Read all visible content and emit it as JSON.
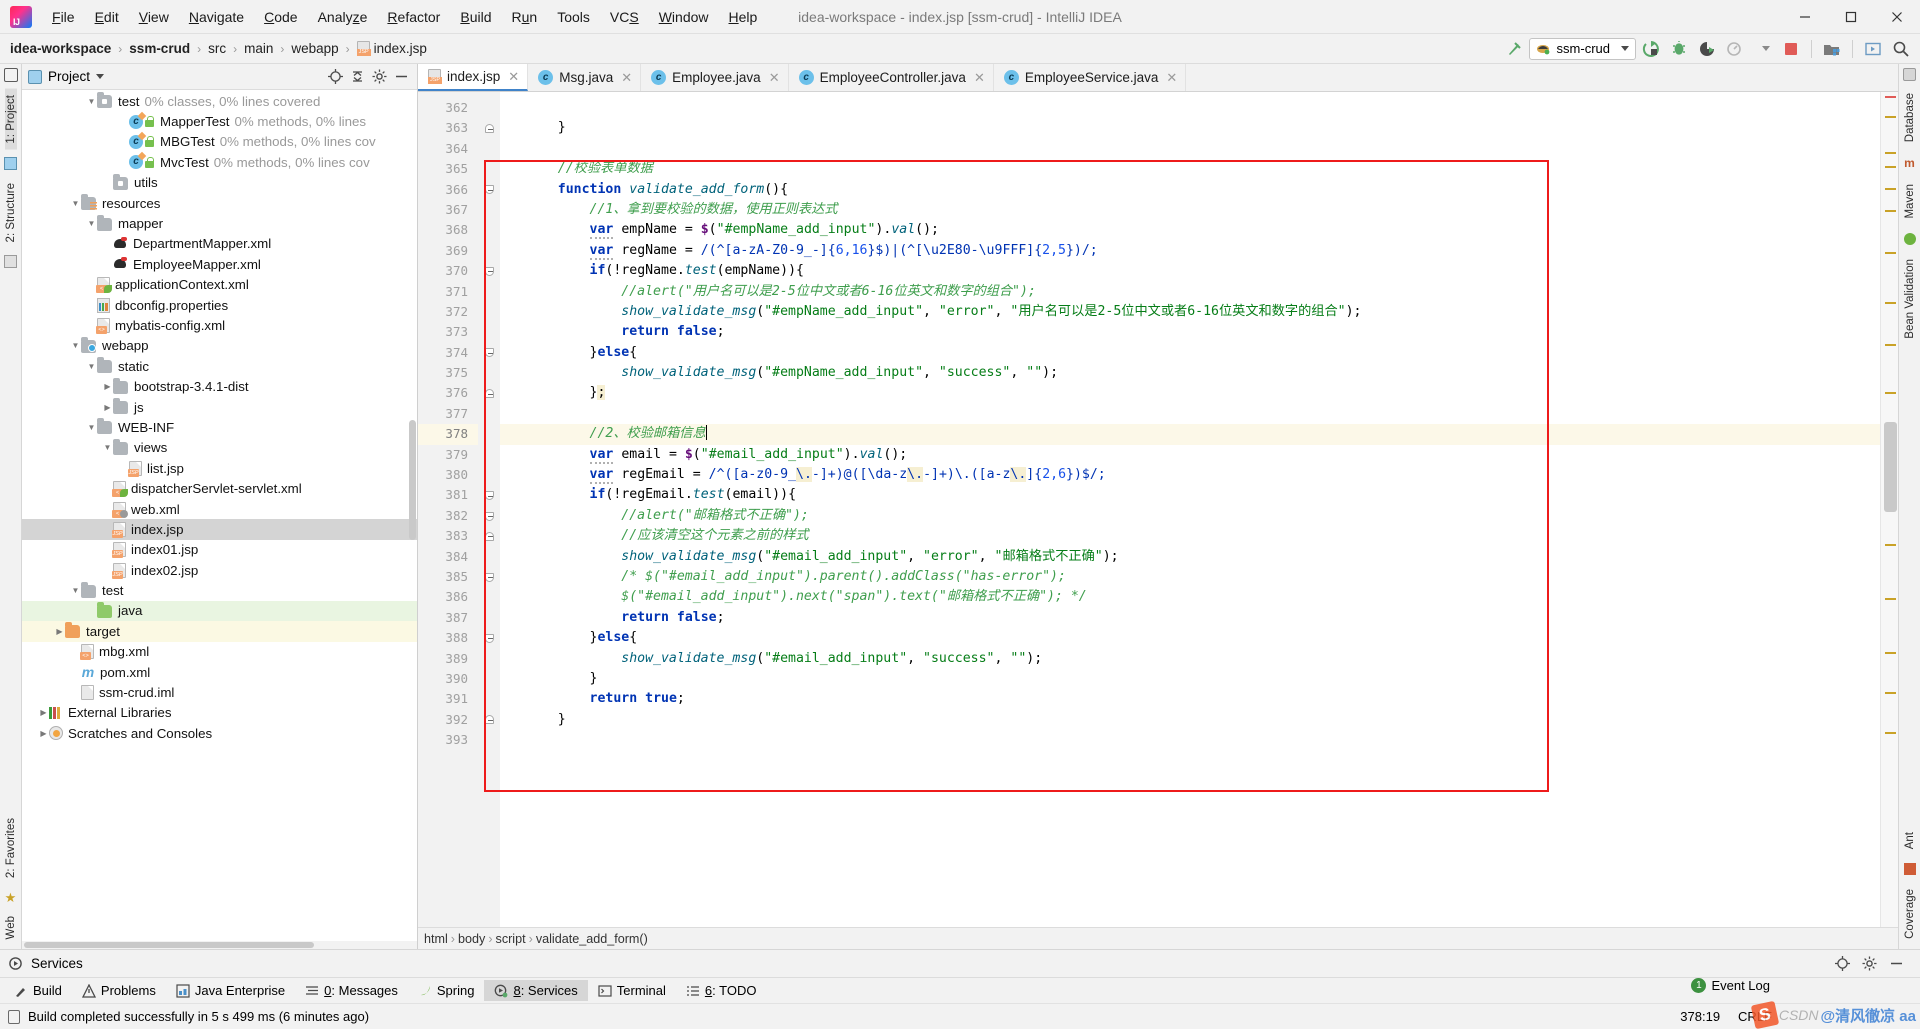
{
  "window": {
    "title": "idea-workspace - index.jsp [ssm-crud] - IntelliJ IDEA",
    "minimize": "─",
    "maximize": "☐",
    "close": "✕"
  },
  "menu": [
    "File",
    "Edit",
    "View",
    "Navigate",
    "Code",
    "Analyze",
    "Refactor",
    "Build",
    "Run",
    "Tools",
    "VCS",
    "Window",
    "Help"
  ],
  "breadcrumb": {
    "segments": [
      "idea-workspace",
      "ssm-crud",
      "src",
      "main",
      "webapp",
      "index.jsp"
    ],
    "separator": "›"
  },
  "toolbar": {
    "run_config": "ssm-crud",
    "icons": [
      "build-hammer-icon",
      "run-icon",
      "debug-icon",
      "run-coverage-icon",
      "profiler-icon",
      "stop-icon",
      "project-structure-icon",
      "updates-icon",
      "search-everywhere-icon"
    ]
  },
  "left_rail": {
    "top": [
      "1: Project",
      "2: Structure"
    ],
    "bottom": [
      "2: Favorites",
      "Web"
    ]
  },
  "right_rail": {
    "top": [
      "Database",
      "Maven",
      "Bean Validation"
    ],
    "bottom": [
      "Ant",
      "Coverage"
    ]
  },
  "project_panel": {
    "title": "Project",
    "tree": [
      {
        "indent": 4,
        "arrow": "down",
        "icon": "folder-test",
        "label": "test",
        "coverage": "0% classes, 0% lines covered"
      },
      {
        "indent": 6,
        "arrow": "none",
        "icon": "class-test",
        "label": "MapperTest",
        "coverage": "0% methods, 0% lines"
      },
      {
        "indent": 6,
        "arrow": "none",
        "icon": "class-test",
        "label": "MBGTest",
        "coverage": "0% methods, 0% lines cov"
      },
      {
        "indent": 6,
        "arrow": "none",
        "icon": "class-test",
        "label": "MvcTest",
        "coverage": "0% methods, 0% lines cov"
      },
      {
        "indent": 5,
        "arrow": "none",
        "icon": "folder-test",
        "label": "utils",
        "coverage": ""
      },
      {
        "indent": 3,
        "arrow": "down",
        "icon": "folder-resources",
        "label": "resources",
        "coverage": ""
      },
      {
        "indent": 4,
        "arrow": "down",
        "icon": "folder-plain",
        "label": "mapper",
        "coverage": ""
      },
      {
        "indent": 5,
        "arrow": "none",
        "icon": "mybatis",
        "label": "DepartmentMapper.xml",
        "coverage": ""
      },
      {
        "indent": 5,
        "arrow": "none",
        "icon": "mybatis",
        "label": "EmployeeMapper.xml",
        "coverage": ""
      },
      {
        "indent": 4,
        "arrow": "none",
        "icon": "spring-xml",
        "label": "applicationContext.xml",
        "coverage": ""
      },
      {
        "indent": 4,
        "arrow": "none",
        "icon": "properties",
        "label": "dbconfig.properties",
        "coverage": ""
      },
      {
        "indent": 4,
        "arrow": "none",
        "icon": "xml",
        "label": "mybatis-config.xml",
        "coverage": ""
      },
      {
        "indent": 3,
        "arrow": "down",
        "icon": "folder-webapp",
        "label": "webapp",
        "coverage": ""
      },
      {
        "indent": 4,
        "arrow": "down",
        "icon": "folder-plain",
        "label": "static",
        "coverage": ""
      },
      {
        "indent": 5,
        "arrow": "right",
        "icon": "folder-plain",
        "label": "bootstrap-3.4.1-dist",
        "coverage": ""
      },
      {
        "indent": 5,
        "arrow": "right",
        "icon": "folder-plain",
        "label": "js",
        "coverage": ""
      },
      {
        "indent": 4,
        "arrow": "down",
        "icon": "folder-plain",
        "label": "WEB-INF",
        "coverage": ""
      },
      {
        "indent": 5,
        "arrow": "down",
        "icon": "folder-plain",
        "label": "views",
        "coverage": ""
      },
      {
        "indent": 6,
        "arrow": "none",
        "icon": "jsp",
        "label": "list.jsp",
        "coverage": ""
      },
      {
        "indent": 5,
        "arrow": "none",
        "icon": "spring-xml",
        "label": "dispatcherServlet-servlet.xml",
        "coverage": ""
      },
      {
        "indent": 5,
        "arrow": "none",
        "icon": "web-xml",
        "label": "web.xml",
        "coverage": ""
      },
      {
        "indent": 5,
        "arrow": "none",
        "icon": "jsp",
        "label": "index.jsp",
        "coverage": "",
        "state": "selected"
      },
      {
        "indent": 5,
        "arrow": "none",
        "icon": "jsp",
        "label": "index01.jsp",
        "coverage": ""
      },
      {
        "indent": 5,
        "arrow": "none",
        "icon": "jsp",
        "label": "index02.jsp",
        "coverage": ""
      },
      {
        "indent": 3,
        "arrow": "down",
        "icon": "folder-plain",
        "label": "test",
        "coverage": ""
      },
      {
        "indent": 4,
        "arrow": "none",
        "icon": "folder-green",
        "label": "java",
        "coverage": "",
        "state": "green"
      },
      {
        "indent": 2,
        "arrow": "right",
        "icon": "folder-orange",
        "label": "target",
        "coverage": "",
        "state": "yellow"
      },
      {
        "indent": 3,
        "arrow": "none",
        "icon": "xml",
        "label": "mbg.xml",
        "coverage": ""
      },
      {
        "indent": 3,
        "arrow": "none",
        "icon": "maven",
        "label": "pom.xml",
        "coverage": ""
      },
      {
        "indent": 3,
        "arrow": "none",
        "icon": "xml-plain",
        "label": "ssm-crud.iml",
        "coverage": ""
      },
      {
        "indent": 1,
        "arrow": "right",
        "icon": "libraries",
        "label": "External Libraries",
        "coverage": ""
      },
      {
        "indent": 1,
        "arrow": "right",
        "icon": "scratches",
        "label": "Scratches and Consoles",
        "coverage": ""
      }
    ]
  },
  "editor": {
    "tabs": [
      {
        "label": "index.jsp",
        "icon": "jsp-icon",
        "active": true
      },
      {
        "label": "Msg.java",
        "icon": "java-class-icon",
        "active": false
      },
      {
        "label": "Employee.java",
        "icon": "java-class-icon",
        "active": false
      },
      {
        "label": "EmployeeController.java",
        "icon": "java-class-icon",
        "active": false
      },
      {
        "label": "EmployeeService.java",
        "icon": "java-class-icon",
        "active": false
      }
    ],
    "first_line": 362,
    "highlight_line": 378,
    "lines": [
      {
        "n": 362,
        "fold": "",
        "html": ""
      },
      {
        "n": 363,
        "fold": "closeb",
        "html": "    <span class=\"pn\">}</span>"
      },
      {
        "n": 364,
        "fold": "",
        "html": ""
      },
      {
        "n": 365,
        "fold": "",
        "html": "    <span class=\"cm\">//校验表单数据</span>"
      },
      {
        "n": 366,
        "fold": "open",
        "html": "    <span class=\"k\">function</span> <span class=\"fn\">validate_add_form</span><span class=\"pn\">(){</span>"
      },
      {
        "n": 367,
        "fold": "",
        "html": "        <span class=\"cm\">//1、拿到要校验的数据，使用正则表达式</span>"
      },
      {
        "n": 368,
        "fold": "",
        "html": "        <span class=\"k wv\">var</span> <span class=\"pn\">empName = </span><span class=\"dl\">$</span><span class=\"pn\">(</span><span class=\"st\">\"#empName_add_input\"</span><span class=\"pn\">).</span><span class=\"fn\">val</span><span class=\"pn\">();</span>"
      },
      {
        "n": 369,
        "fold": "",
        "html": "        <span class=\"k wv\">var</span> <span class=\"pn\">regName = </span><span class=\"sq\">/(^[a-zA-Z0-9_-]{</span><span class=\"nu\">6,16</span><span class=\"sq\">}$)|(^[\\u2E80-\\u9FFF]{</span><span class=\"nu\">2,5</span><span class=\"sq\">})/;</span>"
      },
      {
        "n": 370,
        "fold": "open",
        "html": "        <span class=\"k\">if</span><span class=\"pn\">(!</span><span class=\"pn\">regName.</span><span class=\"fn\">test</span><span class=\"pn\">(empName)){</span>"
      },
      {
        "n": 371,
        "fold": "",
        "html": "            <span class=\"cm\">//alert(\"用户名可以是2-5位中文或者6-16位英文和数字的组合\");</span>"
      },
      {
        "n": 372,
        "fold": "",
        "html": "            <span class=\"fn\">show_validate_msg</span><span class=\"pn\">(</span><span class=\"st\">\"#empName_add_input\"</span><span class=\"pn\">, </span><span class=\"st\">\"error\"</span><span class=\"pn\">, </span><span class=\"st\">\"用户名可以是2-5位中文或者6-16位英文和数字的组合\"</span><span class=\"pn\">);</span>"
      },
      {
        "n": 373,
        "fold": "",
        "html": "            <span class=\"k\">return</span> <span class=\"k\">false</span><span class=\"pn\">;</span>"
      },
      {
        "n": 374,
        "fold": "open",
        "html": "        <span class=\"pn\">}</span><span class=\"k\">else</span><span class=\"pn\">{</span>"
      },
      {
        "n": 375,
        "fold": "",
        "html": "            <span class=\"fn\">show_validate_msg</span><span class=\"pn\">(</span><span class=\"st\">\"#empName_add_input\"</span><span class=\"pn\">, </span><span class=\"st\">\"success\"</span><span class=\"pn\">, </span><span class=\"st\">\"\"</span><span class=\"pn\">);</span>"
      },
      {
        "n": 376,
        "fold": "closeb",
        "html": "        <span class=\"pn\">}</span><span class=\"hlbg\">;</span>"
      },
      {
        "n": 377,
        "fold": "",
        "html": ""
      },
      {
        "n": 378,
        "fold": "",
        "html": "        <span class=\"cm\">//2、校验邮箱信息</span><span class=\"caret\"></span>",
        "highlight": true
      },
      {
        "n": 379,
        "fold": "",
        "html": "        <span class=\"k wv\">var</span> <span class=\"pn\">email = </span><span class=\"dl\">$</span><span class=\"pn\">(</span><span class=\"st\">\"#email_add_input\"</span><span class=\"pn\">).</span><span class=\"fn\">val</span><span class=\"pn\">();</span>"
      },
      {
        "n": 380,
        "fold": "",
        "html": "        <span class=\"k wv\">var</span> <span class=\"pn\">regEmail = </span><span class=\"sq\">/^([a-z0-9_</span><span class=\"hlbg sq\">\\.</span><span class=\"sq\">-]+)@([\\da-z</span><span class=\"hlbg sq\">\\.</span><span class=\"sq\">-]+)\\.([a-z</span><span class=\"hlbg sq\">\\.</span><span class=\"sq\">]{</span><span class=\"nu\">2,6</span><span class=\"sq\">})$/;</span>"
      },
      {
        "n": 381,
        "fold": "open",
        "html": "        <span class=\"k\">if</span><span class=\"pn\">(!</span><span class=\"pn\">regEmail.</span><span class=\"fn\">test</span><span class=\"pn\">(email)){</span>"
      },
      {
        "n": 382,
        "fold": "open",
        "html": "            <span class=\"cm\">//alert(\"邮箱格式不正确\");</span>"
      },
      {
        "n": 383,
        "fold": "closeb",
        "html": "            <span class=\"cm\">//应该清空这个元素之前的样式</span>"
      },
      {
        "n": 384,
        "fold": "",
        "html": "            <span class=\"fn\">show_validate_msg</span><span class=\"pn\">(</span><span class=\"st\">\"#email_add_input\"</span><span class=\"pn\">, </span><span class=\"st\">\"error\"</span><span class=\"pn\">, </span><span class=\"st\">\"邮箱格式不正确\"</span><span class=\"pn\">);</span>"
      },
      {
        "n": 385,
        "fold": "open",
        "html": "            <span class=\"cm\">/* $(\"#email_add_input\").parent().addClass(\"has-error\");</span>"
      },
      {
        "n": 386,
        "fold": "",
        "html": "            <span class=\"cm\">$(\"#email_add_input\").next(\"span\").text(\"邮箱格式不正确\"); */</span>"
      },
      {
        "n": 387,
        "fold": "",
        "html": "            <span class=\"k\">return</span> <span class=\"k\">false</span><span class=\"pn\">;</span>"
      },
      {
        "n": 388,
        "fold": "open",
        "html": "        <span class=\"pn\">}</span><span class=\"k\">else</span><span class=\"pn\">{</span>"
      },
      {
        "n": 389,
        "fold": "",
        "html": "            <span class=\"fn\">show_validate_msg</span><span class=\"pn\">(</span><span class=\"st\">\"#email_add_input\"</span><span class=\"pn\">, </span><span class=\"st\">\"success\"</span><span class=\"pn\">, </span><span class=\"st\">\"\"</span><span class=\"pn\">);</span>"
      },
      {
        "n": 390,
        "fold": "",
        "html": "        <span class=\"pn\">}</span>"
      },
      {
        "n": 391,
        "fold": "",
        "html": "        <span class=\"k\">return</span> <span class=\"k\">true</span><span class=\"pn\">;</span>"
      },
      {
        "n": 392,
        "fold": "closeb",
        "html": "    <span class=\"pn\">}</span>"
      },
      {
        "n": 393,
        "fold": "",
        "html": ""
      }
    ],
    "breadcrumb": [
      "html",
      "body",
      "script",
      "validate_add_form()"
    ]
  },
  "bottom": {
    "services_title": "Services",
    "tool_windows": [
      {
        "label": "Build",
        "icon": "build-icon",
        "accel": "",
        "selected": false
      },
      {
        "label": "Problems",
        "icon": "warning-icon",
        "accel": "",
        "selected": false
      },
      {
        "label": "Java Enterprise",
        "icon": "java-ee-icon",
        "accel": "",
        "selected": false
      },
      {
        "label": "0: Messages",
        "icon": "messages-icon",
        "accel": "0",
        "selected": false
      },
      {
        "label": "Spring",
        "icon": "spring-icon",
        "accel": "",
        "selected": false
      },
      {
        "label": "8: Services",
        "icon": "services-icon",
        "accel": "8",
        "selected": true
      },
      {
        "label": "Terminal",
        "icon": "terminal-icon",
        "accel": "",
        "selected": false
      },
      {
        "label": "6: TODO",
        "icon": "todo-icon",
        "accel": "6",
        "selected": false
      }
    ],
    "status_text": "Build completed successfully in 5 s 499 ms (6 minutes ago)",
    "event_log": "Event Log",
    "event_log_count": "1",
    "caret_position": "378:19",
    "line_separator": "CRLF",
    "watermark": {
      "s": "S",
      "csdn": "CSDN",
      "author": "@清风徹凉 aa"
    }
  }
}
